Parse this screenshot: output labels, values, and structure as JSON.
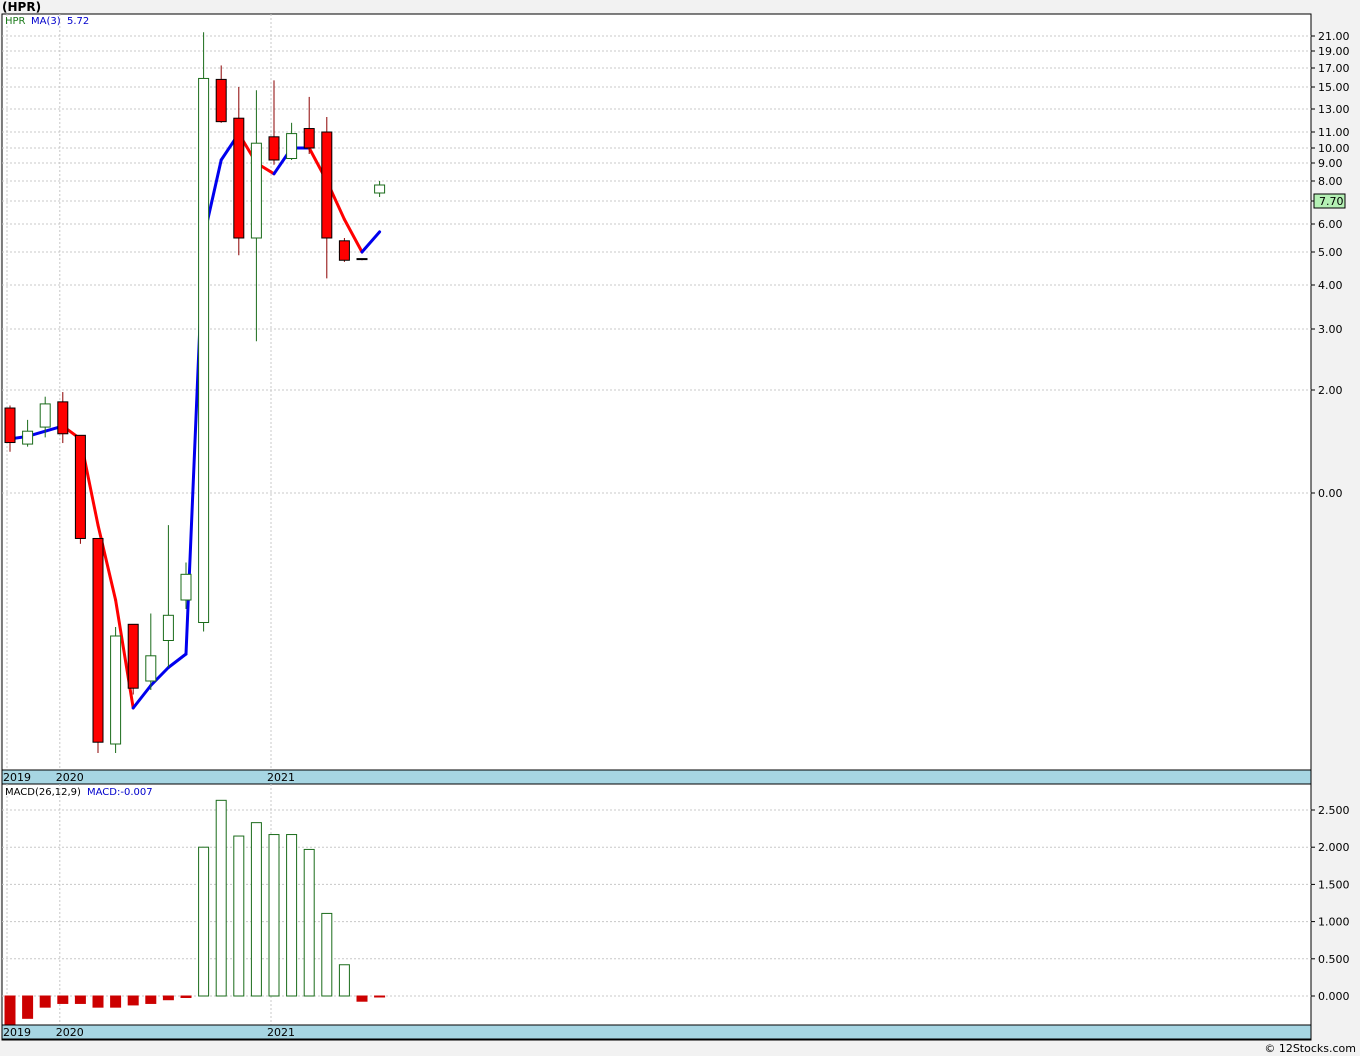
{
  "title": "(HPR)",
  "footer": "© 12Stocks.com",
  "colors": {
    "up_fill": "#ffffff",
    "up_stroke": "#1a6b1a",
    "down_fill": "#ff0000",
    "down_stroke": "#000000",
    "ma_up": "#0000ee",
    "ma_down": "#ff0000",
    "macd_pos": "#1a6b1a",
    "macd_neg": "#cc0000",
    "date_band": "#a7d6e3",
    "last_price_bg": "#b4f0b4",
    "legend_symbol": "#1a7a1a",
    "legend_ma": "#0000cc"
  },
  "price_panel": {
    "legend": {
      "symbol": "HPR",
      "ma_label": "MA(3)",
      "ma_value": "5.72"
    },
    "last_price": "7.70",
    "y_ticks": [
      "21.00",
      "19.00",
      "17.00",
      "15.00",
      "13.00",
      "11.00",
      "10.00",
      "9.00",
      "8.00",
      "7.00",
      "6.00",
      "5.00",
      "4.00",
      "3.00",
      "2.00",
      "0.00"
    ],
    "x_labels": [
      "2019",
      "2020",
      "2021"
    ]
  },
  "macd_panel": {
    "legend": {
      "label": "MACD(26,12,9)",
      "value_label": "MACD:-0.007"
    },
    "y_ticks": [
      "2.500",
      "2.000",
      "1.500",
      "1.000",
      "0.500",
      "0.000"
    ],
    "x_labels": [
      "2019",
      "2020",
      "2021"
    ]
  },
  "chart_data": [
    {
      "type": "candlestick",
      "title": "(HPR)",
      "period": "monthly",
      "y_ticks": [
        21,
        19,
        17,
        15,
        13,
        11,
        10,
        9,
        8,
        7,
        6,
        5,
        4,
        3,
        2,
        0
      ],
      "x_labels": [
        "2019",
        "2020",
        "2021"
      ],
      "candles": [
        {
          "o": 1.65,
          "h": 1.7,
          "l": 0.8,
          "c": 0.98
        },
        {
          "o": 0.95,
          "h": 1.42,
          "l": 0.9,
          "c": 1.2
        },
        {
          "o": 1.28,
          "h": 1.87,
          "l": 1.08,
          "c": 1.73
        },
        {
          "o": 1.77,
          "h": 1.96,
          "l": 0.97,
          "c": 1.15
        },
        {
          "o": 1.12,
          "h": 1.12,
          "l": -0.95,
          "c": -0.85
        },
        {
          "o": -0.85,
          "h": -0.92,
          "l": -3.7,
          "c": -3.58
        },
        {
          "o": -3.6,
          "h": -2.3,
          "l": -3.7,
          "c": -2.4
        },
        {
          "o": -2.27,
          "h": -2.27,
          "l": -3.05,
          "c": -2.98
        },
        {
          "o": -2.9,
          "h": -2.15,
          "l": -3.0,
          "c": -2.62
        },
        {
          "o": -2.45,
          "h": -0.6,
          "l": -2.75,
          "c": -2.17
        },
        {
          "o": -2.0,
          "h": -1.3,
          "l": -2.1,
          "c": -1.52
        },
        {
          "o": -2.25,
          "h": 21.5,
          "l": -2.35,
          "c": 15.9
        },
        {
          "o": 15.8,
          "h": 17.3,
          "l": 11.8,
          "c": 11.9
        },
        {
          "o": 12.2,
          "h": 15.0,
          "l": 4.9,
          "c": 5.5
        },
        {
          "o": 5.5,
          "h": 14.7,
          "l": 2.8,
          "c": 10.3
        },
        {
          "o": 10.7,
          "h": 15.7,
          "l": 8.9,
          "c": 9.2
        },
        {
          "o": 9.3,
          "h": 11.8,
          "l": 9.2,
          "c": 10.9
        },
        {
          "o": 11.3,
          "h": 14.1,
          "l": 9.6,
          "c": 10.0
        },
        {
          "o": 11.0,
          "h": 12.3,
          "l": 4.2,
          "c": 5.5
        },
        {
          "o": 5.4,
          "h": 5.5,
          "l": 4.7,
          "c": 4.75
        },
        {
          "o": 4.8,
          "h": 4.8,
          "l": 4.75,
          "c": 4.78
        },
        {
          "o": 7.4,
          "h": 8.0,
          "l": 7.2,
          "c": 7.8
        }
      ],
      "series": [
        {
          "name": "MA(3)",
          "values": [
            1.05,
            1.1,
            1.2,
            1.3,
            1.05,
            -0.6,
            -2.0,
            -3.2,
            -2.95,
            -2.75,
            -2.6,
            5.5,
            9.2,
            10.9,
            9.0,
            8.4,
            10.0,
            10.0,
            8.0,
            6.2,
            5.0,
            5.72
          ]
        }
      ]
    },
    {
      "type": "bar",
      "title": "MACD(26,12,9)",
      "ylim": [
        -0.4,
        2.7
      ],
      "y_ticks": [
        2.5,
        2.0,
        1.5,
        1.0,
        0.5,
        0.0
      ],
      "x_labels": [
        "2019",
        "2020",
        "2021"
      ],
      "series": [
        {
          "name": "MACD",
          "values": [
            -0.4,
            -0.3,
            -0.15,
            -0.1,
            -0.1,
            -0.15,
            -0.15,
            -0.12,
            -0.1,
            -0.05,
            -0.02,
            2.0,
            2.63,
            2.15,
            2.33,
            2.17,
            2.17,
            1.97,
            1.11,
            0.42,
            -0.07,
            -0.007
          ]
        }
      ]
    }
  ]
}
